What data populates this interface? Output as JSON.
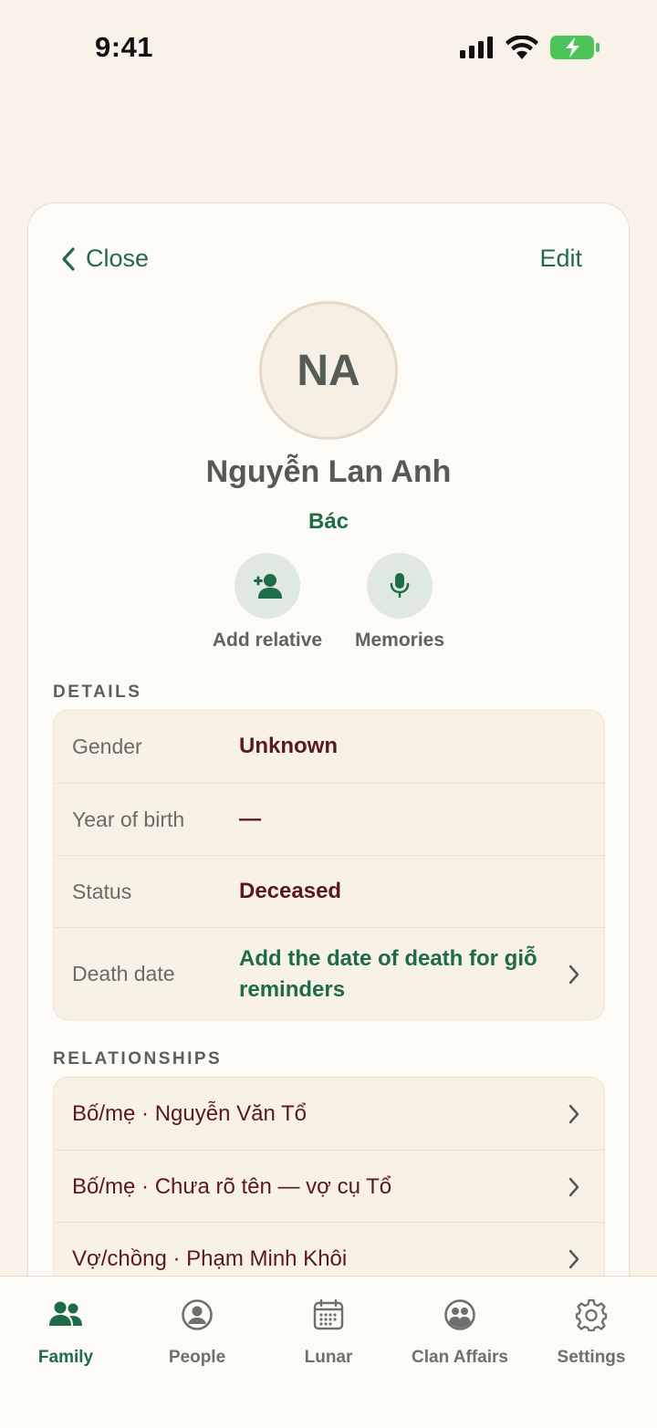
{
  "status_bar": {
    "time": "9:41"
  },
  "nav": {
    "close_label": "Close",
    "edit_label": "Edit"
  },
  "profile": {
    "initials": "NA",
    "name": "Nguyễn Lan Anh",
    "role": "Bác"
  },
  "actions": [
    {
      "label": "Add relative",
      "icon": "add-person-icon"
    },
    {
      "label": "Memories",
      "icon": "microphone-icon"
    }
  ],
  "details": {
    "section_title": "DETAILS",
    "rows": [
      {
        "key": "Gender",
        "value": "Unknown"
      },
      {
        "key": "Year of birth",
        "value": "—"
      },
      {
        "key": "Status",
        "value": "Deceased"
      },
      {
        "key": "Death date",
        "value": "Add the date of death for giỗ reminders"
      }
    ]
  },
  "relationships": {
    "section_title": "RELATIONSHIPS",
    "items": [
      {
        "label": "Bố/mẹ · Nguyễn Văn Tổ"
      },
      {
        "label": "Bố/mẹ · Chưa rõ tên — vợ cụ Tổ"
      },
      {
        "label": "Vợ/chồng · Phạm Minh Khôi"
      }
    ]
  },
  "tabs": [
    {
      "label": "Family",
      "icon": "family-icon",
      "active": true
    },
    {
      "label": "People",
      "icon": "person-circle-icon"
    },
    {
      "label": "Lunar",
      "icon": "calendar-icon"
    },
    {
      "label": "Clan Affairs",
      "icon": "group-icon"
    },
    {
      "label": "Settings",
      "icon": "gear-icon"
    }
  ],
  "colors": {
    "accent": "#1e6b47",
    "background": "#f8f2e8",
    "value_text": "#5a1a1a"
  }
}
